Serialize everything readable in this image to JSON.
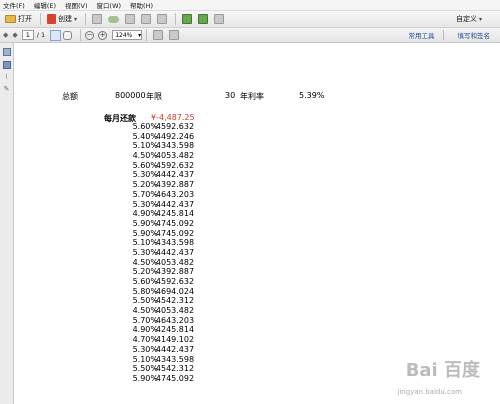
{
  "menu": [
    "文件(F)",
    "编辑(E)",
    "视图(V)",
    "窗口(W)",
    "帮助(H)"
  ],
  "toolbar": {
    "open_label": "打开",
    "create_label": "创建",
    "custom_label": "自定义"
  },
  "navbar": {
    "page_current": "1",
    "page_total": "/ 1",
    "zoom": "124%",
    "tools_link": "常用工具",
    "sign_link": "填写和签名"
  },
  "sheet": {
    "total_label": "总额",
    "total_value": "800000",
    "years_label": "年限",
    "years_value": "30",
    "rate_label": "年利率",
    "rate_value": "5.39%",
    "payment_heading": "每月还款",
    "first_payment": "¥-4,487.25",
    "rows": [
      {
        "rate": "5.60%",
        "payment": "-4592.632"
      },
      {
        "rate": "5.40%",
        "payment": "-4492.246"
      },
      {
        "rate": "5.10%",
        "payment": "-4343.598"
      },
      {
        "rate": "4.50%",
        "payment": "-4053.482"
      },
      {
        "rate": "5.60%",
        "payment": "-4592.632"
      },
      {
        "rate": "5.30%",
        "payment": "-4442.437"
      },
      {
        "rate": "5.20%",
        "payment": "-4392.887"
      },
      {
        "rate": "5.70%",
        "payment": "-4643.203"
      },
      {
        "rate": "5.30%",
        "payment": "-4442.437"
      },
      {
        "rate": "4.90%",
        "payment": "-4245.814"
      },
      {
        "rate": "5.90%",
        "payment": "-4745.092"
      },
      {
        "rate": "5.90%",
        "payment": "-4745.092"
      },
      {
        "rate": "5.10%",
        "payment": "-4343.598"
      },
      {
        "rate": "5.30%",
        "payment": "-4442.437"
      },
      {
        "rate": "4.50%",
        "payment": "-4053.482"
      },
      {
        "rate": "5.20%",
        "payment": "-4392.887"
      },
      {
        "rate": "5.60%",
        "payment": "-4592.632"
      },
      {
        "rate": "5.80%",
        "payment": "-4694.024"
      },
      {
        "rate": "5.50%",
        "payment": "-4542.312"
      },
      {
        "rate": "4.50%",
        "payment": "-4053.482"
      },
      {
        "rate": "5.70%",
        "payment": "-4643.203"
      },
      {
        "rate": "4.90%",
        "payment": "-4245.814"
      },
      {
        "rate": "4.70%",
        "payment": "-4149.102"
      },
      {
        "rate": "5.30%",
        "payment": "-4442.437"
      },
      {
        "rate": "5.10%",
        "payment": "-4343.598"
      },
      {
        "rate": "5.50%",
        "payment": "-4542.312"
      },
      {
        "rate": "5.90%",
        "payment": "-4745.092"
      }
    ]
  },
  "watermark": {
    "text": "Bai  百度",
    "url": "jingyan.baidu.com"
  }
}
